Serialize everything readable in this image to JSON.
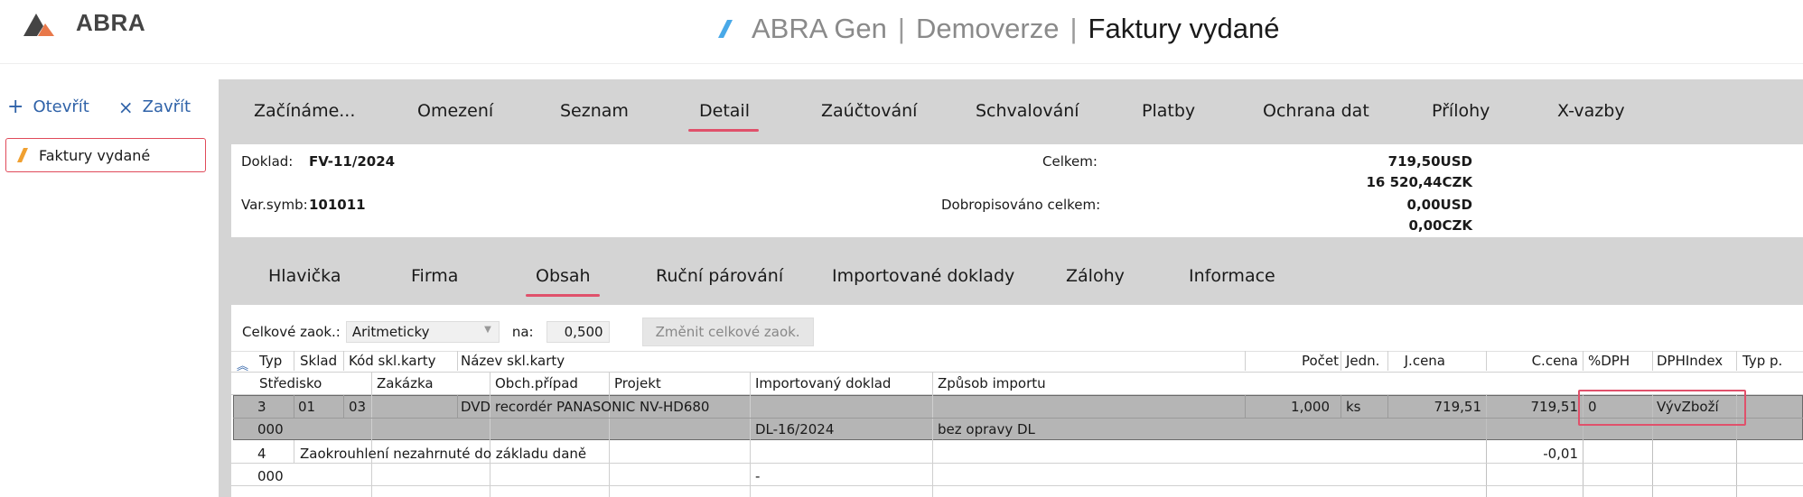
{
  "header": {
    "logo_text": "ABRA",
    "title_app": "ABRA Gen",
    "title_sep": "|",
    "title_env": "Demoverze",
    "title_page": "Faktury vydané"
  },
  "sidebar": {
    "open_label": "Otevřít",
    "close_label": "Zavřít",
    "open_doc": "Faktury vydané"
  },
  "main_tabs": [
    "Začínáme...",
    "Omezení",
    "Seznam",
    "Detail",
    "Zaúčtování",
    "Schvalování",
    "Platby",
    "Ochrana dat",
    "Přílohy",
    "X-vazby"
  ],
  "doc": {
    "doklad_label": "Doklad:",
    "doklad_value": "FV-11/2024",
    "varsymb_label": "Var.symb:",
    "varsymb_value": "101011",
    "celkem_label": "Celkem:",
    "celkem_usd": "719,50USD",
    "celkem_czk": "16 520,44CZK",
    "dobropis_label": "Dobropisováno celkem:",
    "dobropis_usd": "0,00USD",
    "dobropis_czk": "0,00CZK"
  },
  "sub_tabs": [
    "Hlavička",
    "Firma",
    "Obsah",
    "Ruční párování",
    "Importované doklady",
    "Zálohy",
    "Informace"
  ],
  "rounding": {
    "label": "Celkové zaok.:",
    "method": "Aritmeticky",
    "na_label": "na:",
    "value": "0,500",
    "change_button": "Změnit celkové zaok."
  },
  "grid": {
    "header1": [
      "Typ",
      "Sklad",
      "Kód skl.karty",
      "Název skl.karty",
      "Počet",
      "Jedn.",
      "J.cena",
      "C.cena",
      "%DPH",
      "DPHIndex",
      "Typ p."
    ],
    "header2": [
      "Středisko",
      "Zakázka",
      "Obch.případ",
      "Projekt",
      "Importovaný doklad",
      "Způsob importu"
    ],
    "rows": [
      {
        "typ": "3",
        "sklad": "01",
        "kod": "03",
        "nazev": "DVD recordér PANASONIC NV-HD680",
        "pocet": "1,000",
        "jedn": "ks",
        "jcena": "719,51",
        "ccena": "719,51",
        "dph": "0",
        "dphindex": "VývZboží",
        "stredisko": "000",
        "imp_doklad": "DL-16/2024",
        "zpusob": "bez opravy DL"
      },
      {
        "typ": "4",
        "nazev": "Zaokrouhlení nezahrnuté do základu daně",
        "ccena": "-0,01",
        "stredisko": "000",
        "imp_doklad": "-"
      }
    ]
  }
}
